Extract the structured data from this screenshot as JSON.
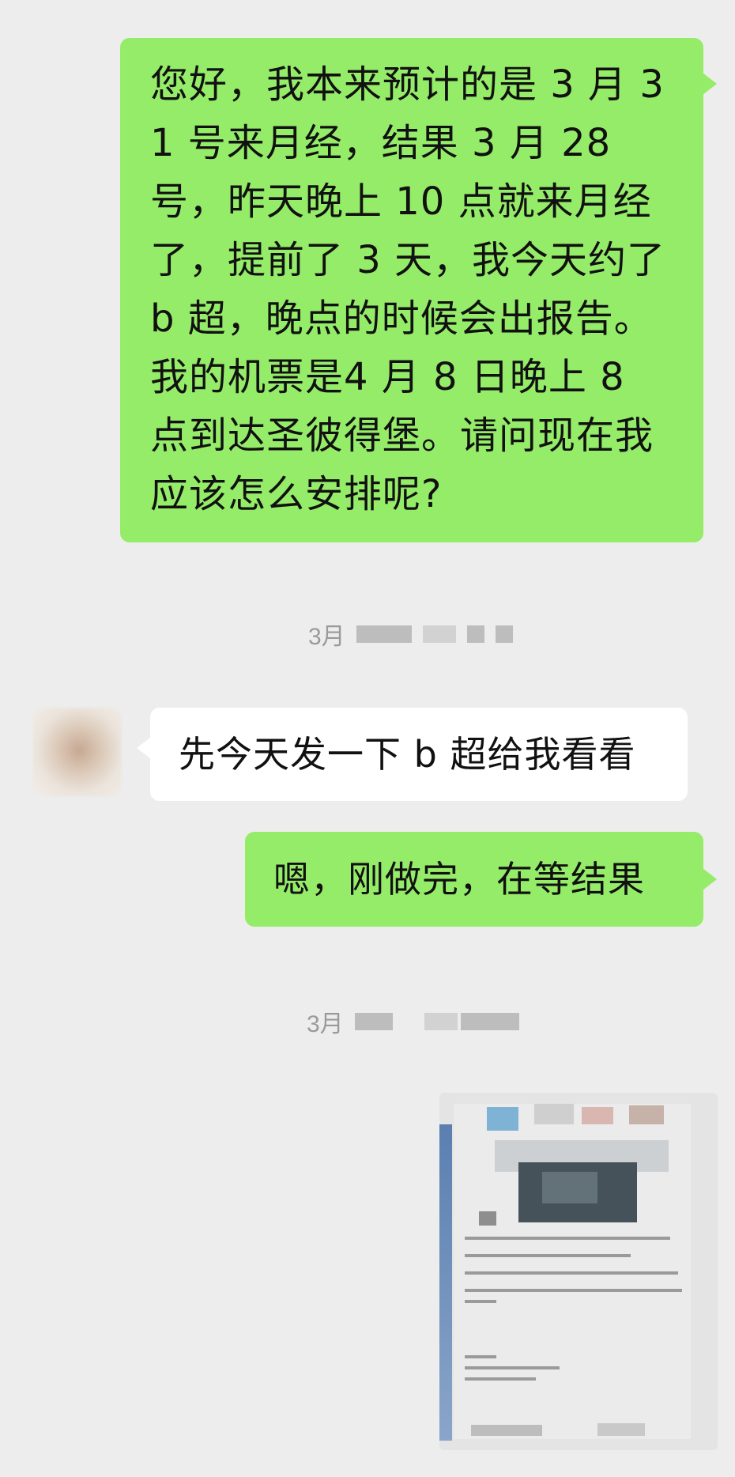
{
  "messages": [
    {
      "side": "sent",
      "text": "您好，我本来预计的是 3 月 31 号来月经，结果 3 月 28 号，昨天晚上 10 点就来月经了，提前了 3 天，我今天约了 b 超，晚点的时候会出报告。我的机票是4 月 8 日晚上 8 点到达圣彼得堡。请问现在我应该怎么安排呢?"
    },
    {
      "side": "received",
      "text": "先今天发一下 b 超给我看看"
    },
    {
      "side": "sent",
      "text": "嗯，刚做完，在等结果"
    }
  ],
  "timestamps": [
    {
      "text": "3月"
    },
    {
      "text": "3月"
    }
  ],
  "image_message": {
    "icon": "ultrasound-report-photo"
  },
  "colors": {
    "sent_bubble": "#95ec69",
    "received_bubble": "#ffffff",
    "background": "#ededed"
  }
}
